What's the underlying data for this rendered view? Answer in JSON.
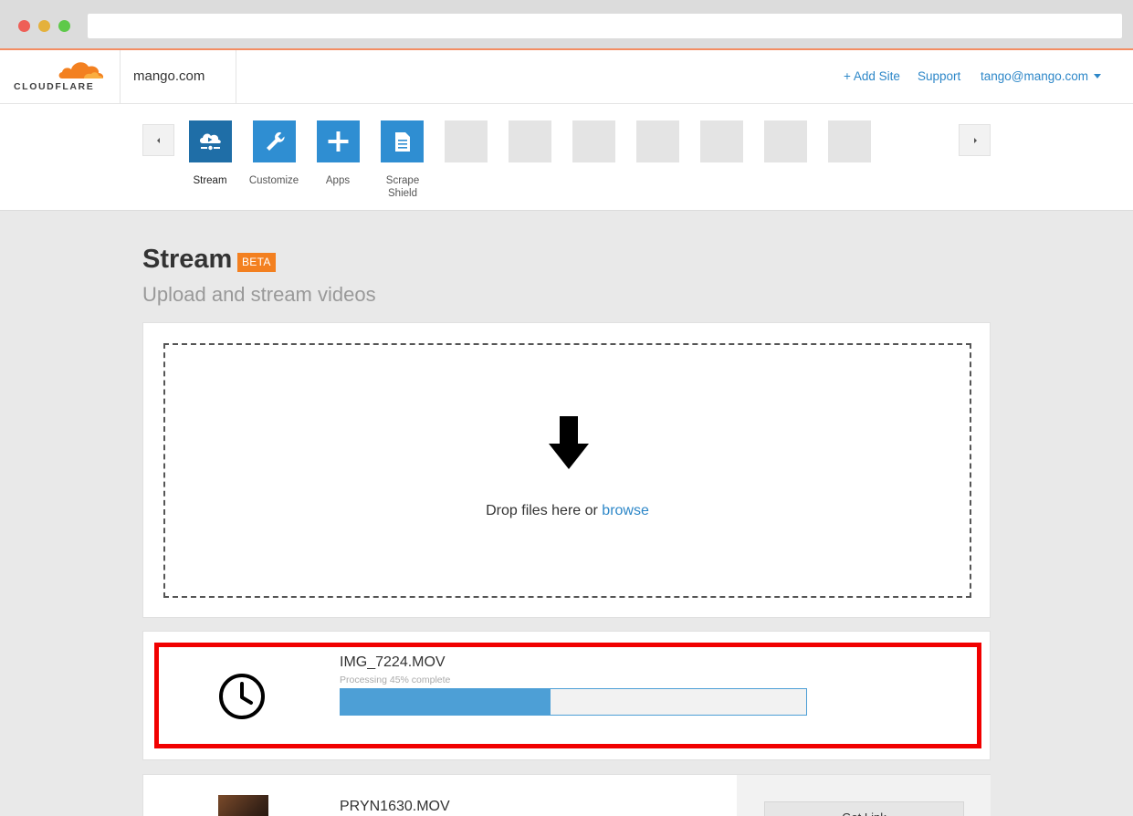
{
  "browser": {
    "window_controls": [
      "close",
      "minimize",
      "maximize"
    ]
  },
  "header": {
    "logo_text": "CLOUDFLARE",
    "site": "mango.com",
    "nav": {
      "add_site": "+ Add Site",
      "support": "Support",
      "user": "tango@mango.com"
    }
  },
  "apps": {
    "items": [
      {
        "label": "Stream",
        "icon": "stream-cloud-icon",
        "active": true
      },
      {
        "label": "Customize",
        "icon": "wrench-icon",
        "active": false
      },
      {
        "label": "Apps",
        "icon": "plus-icon",
        "active": false
      },
      {
        "label": "Scrape Shield",
        "icon": "document-icon",
        "active": false
      }
    ],
    "placeholder_tiles": 7
  },
  "page": {
    "title": "Stream",
    "badge": "BETA",
    "subtitle": "Upload and stream videos"
  },
  "upload": {
    "drop_text": "Drop files here or",
    "browse_label": "browse"
  },
  "videos": [
    {
      "name": "IMG_7224.MOV",
      "status": "Processing 45% complete",
      "progress": 0.45,
      "icon": "clock-icon",
      "highlighted": true
    },
    {
      "name": "PRYN1630.MOV",
      "action_label": "Get Link",
      "icon": "video-thumbnail"
    }
  ],
  "colors": {
    "brand_orange": "#f38020",
    "link_blue": "#2d87c8",
    "active_tile": "#1f6ea7",
    "tile_blue": "#2f8ed2",
    "progress_fill": "#4d9fd6",
    "highlight_red": "#f10000"
  }
}
